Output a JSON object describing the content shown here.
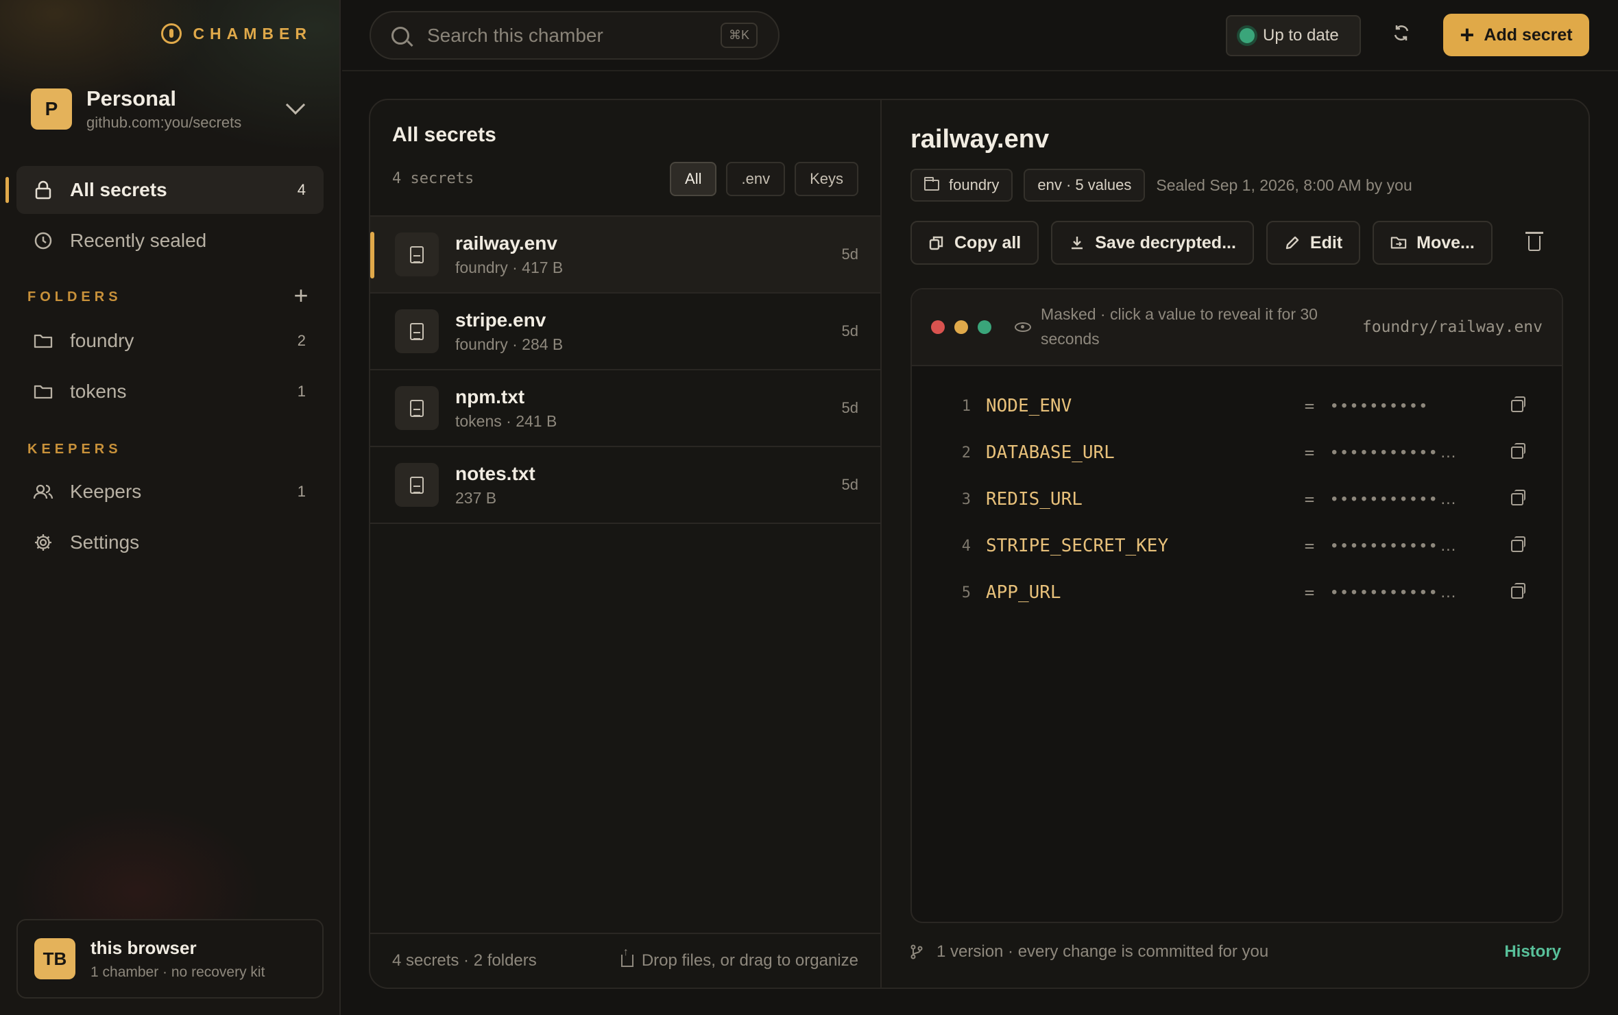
{
  "brand": {
    "name": "CHAMBER"
  },
  "workspace": {
    "avatar": "P",
    "name": "Personal",
    "repo": "github.com:you/secrets"
  },
  "nav": [
    {
      "label": "All secrets",
      "count": "4",
      "icon": "lock-icon"
    },
    {
      "label": "Recently sealed",
      "count": "",
      "icon": "clock-icon"
    }
  ],
  "folders": {
    "section_label": "FOLDERS",
    "items": [
      {
        "label": "foundry",
        "count": "2"
      },
      {
        "label": "tokens",
        "count": "1"
      }
    ]
  },
  "keepers": {
    "section_label": "KEEPERS",
    "items": [
      {
        "label": "Keepers",
        "count": "1",
        "icon": "users-icon"
      },
      {
        "label": "Settings",
        "count": "",
        "icon": "gear-icon"
      }
    ]
  },
  "device": {
    "avatar": "TB",
    "name": "this browser",
    "sub": "1 chamber · no recovery kit"
  },
  "search": {
    "placeholder": "Search this chamber",
    "shortcut": "⌘K"
  },
  "status": {
    "label": "Up to date",
    "color": "#3aa57a"
  },
  "add_button": {
    "label": "Add secret"
  },
  "list": {
    "title": "All secrets",
    "count": "4 secrets",
    "filters": [
      "All",
      ".env",
      "Keys"
    ],
    "items": [
      {
        "name": "railway.env",
        "meta": "foundry · 417 B",
        "age": "5d"
      },
      {
        "name": "stripe.env",
        "meta": "foundry · 284 B",
        "age": "5d"
      },
      {
        "name": "npm.txt",
        "meta": "tokens · 241 B",
        "age": "5d"
      },
      {
        "name": "notes.txt",
        "meta": "237 B",
        "age": "5d"
      }
    ],
    "footer_count": "4 secrets · 2 folders",
    "footer_drop": "Drop files, or drag to organize"
  },
  "detail": {
    "title": "railway.env",
    "folder_tag": "foundry",
    "type_tag": "env · 5 values",
    "sealed": "Sealed Sep 1, 2026, 8:00 AM by you",
    "actions": {
      "copy_all": "Copy all",
      "save": "Save decrypted...",
      "edit": "Edit",
      "move": "Move..."
    },
    "editor": {
      "masked_note": "Masked · click a value to reveal it for 30 seconds",
      "path": "foundry/railway.env",
      "dot_colors": [
        "#d9534f",
        "#e0a94a",
        "#3aa57a"
      ],
      "lines": [
        {
          "n": "1",
          "key": "NODE_ENV",
          "eq": "=",
          "val": "••••••••••"
        },
        {
          "n": "2",
          "key": "DATABASE_URL",
          "eq": "=",
          "val": "•••••••••••…"
        },
        {
          "n": "3",
          "key": "REDIS_URL",
          "eq": "=",
          "val": "•••••••••••…"
        },
        {
          "n": "4",
          "key": "STRIPE_SECRET_KEY",
          "eq": "=",
          "val": "•••••••••••…"
        },
        {
          "n": "5",
          "key": "APP_URL",
          "eq": "=",
          "val": "•••••••••••…"
        }
      ]
    },
    "footer": "1 version · every change is committed for you",
    "history": "History"
  },
  "colors": {
    "accent": "#e0a94a",
    "success": "#3aa57a",
    "link": "#58c09a"
  }
}
